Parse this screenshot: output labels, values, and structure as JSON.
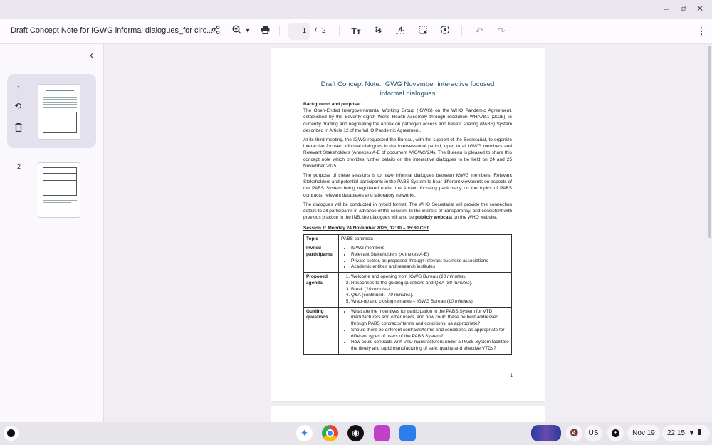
{
  "window": {
    "minimize": "–",
    "restore": "⧉",
    "close": "✕"
  },
  "toolbar": {
    "title": "Draft Concept Note for IGWG informal dialogues_for circ...",
    "page_current": "1",
    "page_sep": "/",
    "page_total": "2",
    "icons": {
      "share": "share-icon",
      "zoom": "zoom-in-icon",
      "dropdown": "▾",
      "print": "print-icon",
      "text": "Tт",
      "draw": "draw-icon",
      "sign": "signature-icon",
      "select": "select-area-icon",
      "scan": "scan-icon",
      "undo": "↶",
      "redo": "↷",
      "more": "⋮"
    }
  },
  "sidebar": {
    "collapse": "‹",
    "pages": [
      {
        "num": "1"
      },
      {
        "num": "2"
      }
    ]
  },
  "doc": {
    "title": "Draft Concept Note: IGWG November interactive focused informal dialogues",
    "bg_heading": "Background and purpose:",
    "paras": [
      "The Open-Ended Intergovernmental Working Group (IGWG) on the WHO Pandemic Agreement, established by the Seventy-eighth World Health Assembly through resolution WHA78.1 (2025), is currently drafting and negotiating the Annex on pathogen access and benefit sharing (PABS) System described in Article 12 of the WHO Pandemic Agreement.",
      "At its third meeting, the IGWG requested the Bureau, with the support of the Secretariat, to organize interactive focused informal dialogues in the intersessional period, open to all IGWG members and Relevant Stakeholders (Annexes A-E of document A/IGWG/2/4). The Bureau is pleased to share this concept note which provides further details on the interactive dialogues to be held on 24 and 25 November 2025.",
      "The purpose of these sessions is to have informal dialogues between IGWG members, Relevant Stakeholders and potential participants in the PABS System to hear different viewpoints on aspects of the PABS System being negotiated under the Annex, focusing particularly on the topics of PABS contracts, relevant databases and laboratory networks."
    ],
    "para4_a": "The dialogues will be conducted in hybrid format. The WHO Secretariat will provide the connection details to all participants in advance of the session. In the interest of transparency, and consistent with previous practice in the INB, the dialogues will also be ",
    "para4_bold": "publicly webcast",
    "para4_b": " on the WHO website.",
    "session": "Session 1: Monday 24 November 2025, 12:30 – 15:30 CET",
    "table": {
      "topic_label": "Topic",
      "topic": "PABS contracts",
      "invited_label": "Invited participants",
      "invited": [
        "IGWG members",
        "Relevant Stakeholders (Annexes A-E)",
        "Private sector, as proposed through relevant business associations",
        "Academic entities and research institutes"
      ],
      "agenda_label": "Proposed agenda",
      "agenda": [
        {
          "text": "Welcome and opening from IGWG Bureau (",
          "dur": "10 minutes",
          "end": ")."
        },
        {
          "text": "Responses to the guiding questions and Q&A (",
          "dur": "80 minutes",
          "end": ")."
        },
        {
          "text": "Break (",
          "dur": "10 minutes",
          "end": ")."
        },
        {
          "text": "Q&A (continued) (",
          "dur": "70 minutes",
          "end": ")."
        },
        {
          "text": "Wrap-up and closing remarks – IGWG Bureau (",
          "dur": "10 minutes",
          "end": ")."
        }
      ],
      "questions_label": "Guiding questions",
      "questions": [
        "What are the incentives for participation in the PABS System for VTD manufacturers and other users, and how could these be best addressed through PABS contracts/ terms and conditions, as appropriate?",
        "Should there be different contracts/terms and conditions, as appropriate for different types of users of the PABS System?",
        "How could contracts with VTD manufacturers under a PABS System facilitate the timely and rapid manufacturing of safe, quality and effective VTDs?"
      ]
    },
    "page_number": "1"
  },
  "taskbar": {
    "keyboard": "US",
    "date": "Nov 19",
    "time": "22:15"
  },
  "colors": {
    "title_blue": "#1d4f6e",
    "selected_thumb": "#e4e1ee"
  }
}
